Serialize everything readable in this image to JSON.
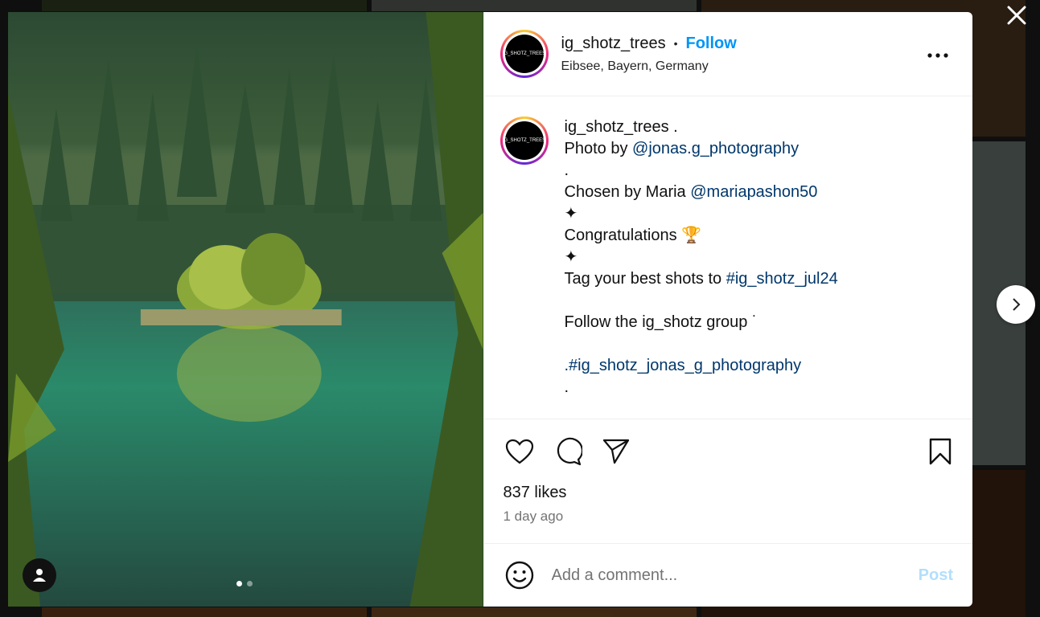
{
  "post": {
    "username": "ig_shotz_trees",
    "separator": "•",
    "follow_label": "Follow",
    "location": "Eibsee, Bayern, Germany",
    "avatar_text": "IG_SHOTZ_TREES"
  },
  "caption": {
    "username": "ig_shotz_trees",
    "after_username": " .",
    "photo_by_prefix": "Photo by ",
    "photo_by_handle": "@jonas.g_photography",
    "dot1": ".",
    "chosen_prefix": "Chosen by Maria ",
    "chosen_handle": "@mariapashon50",
    "sparkle1": "✦",
    "congrats": "Congratulations 🏆",
    "sparkle2": "✦",
    "tag_prefix": "Tag your best shots to ",
    "tag_hashtag": "#ig_shotz_jul24",
    "follow_group": "Follow the ig_shotz group ˙",
    "hashtag_line": ".#ig_shotz_jonas_g_photography",
    "dot2": "."
  },
  "stats": {
    "likes": "837 likes",
    "time": "1 day ago"
  },
  "comment": {
    "placeholder": "Add a comment...",
    "post_label": "Post"
  },
  "carousel": {
    "total": 2,
    "active": 1
  },
  "icons": [
    "close-icon",
    "chevron-right-icon",
    "more-icon",
    "heart-icon",
    "comment-icon",
    "share-icon",
    "bookmark-icon",
    "emoji-icon",
    "user-icon"
  ]
}
